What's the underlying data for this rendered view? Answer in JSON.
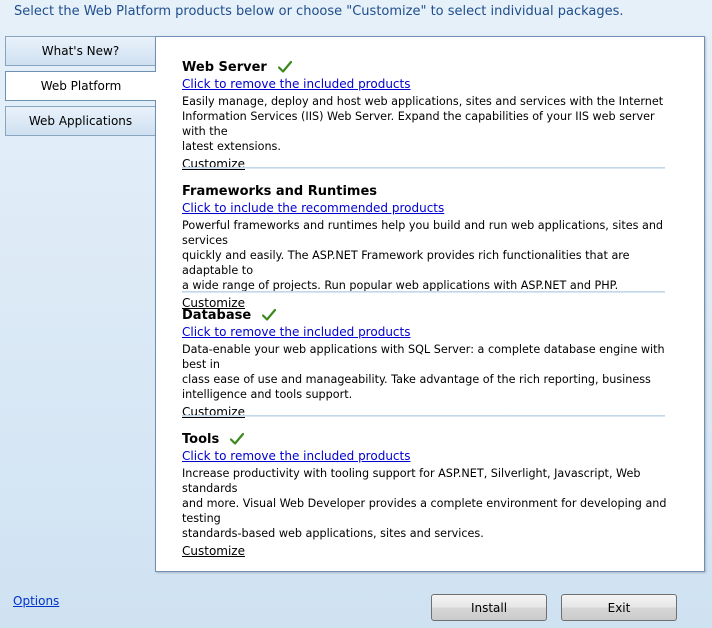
{
  "header": {
    "text": "Select the Web Platform products below or choose \"Customize\" to select individual packages."
  },
  "tabs": [
    {
      "label": "What's New?",
      "active": false
    },
    {
      "label": "Web Platform",
      "active": true
    },
    {
      "label": "Web Applications",
      "active": false
    }
  ],
  "sections": [
    {
      "title": "Web Server",
      "selected": true,
      "link": "Click to remove the included products",
      "desc_lines": [
        "Easily manage, deploy and host web applications, sites and services with the Internet",
        "Information Services (IIS) Web Server.  Expand the capabilities of your IIS web server with the",
        "latest extensions."
      ],
      "customize": "Customize"
    },
    {
      "title": "Frameworks and Runtimes",
      "selected": false,
      "link": "Click to include the recommended products",
      "desc_lines": [
        "Powerful frameworks and runtimes help you build and run web applications, sites and services",
        "quickly and easily.  The ASP.NET Framework provides rich functionalities that are adaptable to",
        "a wide range of projects. Run popular web applications with ASP.NET and PHP."
      ],
      "customize": "Customize"
    },
    {
      "title": "Database",
      "selected": true,
      "link": "Click to remove the included products",
      "desc_lines": [
        "Data-enable your web applications with SQL Server: a complete database engine with best in",
        "class ease of use and manageability. Take advantage of the rich reporting, business",
        "intelligence and tools support."
      ],
      "customize": "Customize"
    },
    {
      "title": "Tools",
      "selected": true,
      "link": "Click to remove the included products",
      "desc_lines": [
        "Increase productivity with tooling support for ASP.NET, Silverlight, Javascript, Web standards",
        "and more. Visual Web Developer provides a complete environment for developing and testing",
        "standards-based web applications, sites and services."
      ],
      "customize": "Customize"
    }
  ],
  "footer": {
    "options_link": "Options",
    "install_label": "Install",
    "exit_label": "Exit"
  },
  "colors": {
    "link": "#0000d0",
    "check": "#3a8a1e",
    "header_text": "#1f4e8c"
  }
}
